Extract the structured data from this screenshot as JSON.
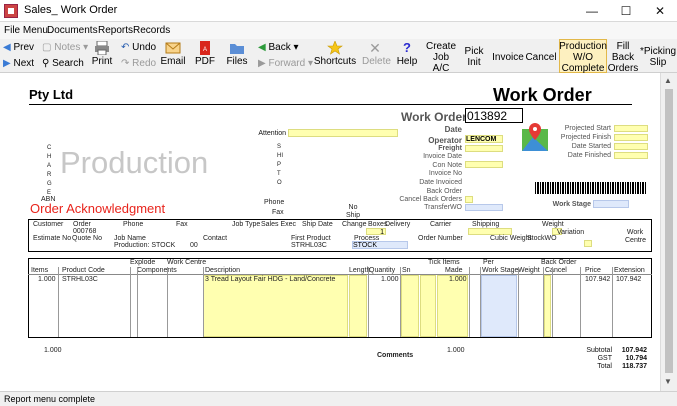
{
  "window": {
    "title": "Sales_ Work Order"
  },
  "menu": [
    "File Menu",
    "Documents",
    "Reports",
    "Records"
  ],
  "toolbar": {
    "prev": "Prev",
    "next": "Next",
    "notes": "Notes",
    "search": "Search",
    "undo": "Undo",
    "redo": "Redo",
    "print": "Print",
    "email": "Email",
    "pdf": "PDF",
    "files": "Files",
    "back": "Back",
    "forward": "Forward",
    "shortcuts": "Shortcuts",
    "delete": "Delete",
    "help": "Help",
    "actions": [
      "Create Job A/C",
      "Pick Init",
      "Invoice",
      "Cancel",
      "Production W/O Complete",
      "Fill Back Orders",
      "*Picking Slip"
    ]
  },
  "doc": {
    "company": "Pty Ltd",
    "heading": "Work Order",
    "wo_label": "Work Order",
    "wo_number": "013892",
    "production": "Production",
    "order_ack": "Order Acknowledgment",
    "attention": "Attention",
    "charge_letters": "CHARGE",
    "abn": "ABN",
    "ship_to_letters": "SHIPTO",
    "phone": "Phone",
    "fax": "Fax",
    "no_ship": "No Ship",
    "fields": {
      "date": "Date",
      "operator": "Operator",
      "operator_value": "LENCOM",
      "freight": "Freight",
      "invoice_date": "Invoice Date",
      "con_note": "Con Note",
      "invoice_no": "Invoice No",
      "date_invoiced": "Date Invoiced",
      "back_order": "Back Order",
      "cancel_back_orders": "Cancel Back Orders",
      "transfer_wo": "TransferWO",
      "work_stage": "Work Stage"
    },
    "right_fields": [
      "Projected Start",
      "Projected Finish",
      "Date Started",
      "Date Finished"
    ],
    "info_row1_labels": [
      "Customer",
      "Order",
      "Phone",
      "Fax",
      "Job Type",
      "Sales Exec",
      "Ship Date",
      "Change",
      "Boxes",
      "Delivery",
      "Carrier",
      "Shipping",
      "Weight"
    ],
    "order_value": "000768",
    "boxes_value": "1",
    "info_row2_labels": [
      "Estimate No",
      "Quote No",
      "Job Name",
      "Contact",
      "First Product",
      "Process",
      "Order Number",
      "Cubic Weight",
      "StockWO",
      "Variation",
      "Work Centre"
    ],
    "job_name_value": "Production: STOCK",
    "contact_value": "00",
    "first_product_value": "STRHL03C",
    "process_value": "STOCK",
    "lines_head1": [
      "Explode",
      "Work Centre",
      "Tick Items",
      "Per",
      "Back Order"
    ],
    "lines_head2": [
      "Items",
      "Product Code",
      "Components",
      "Description",
      "Length",
      "Quantity",
      "Sn",
      "Made",
      "Work Stage",
      "Weight",
      "Cancel",
      "Price",
      "Extension"
    ],
    "line": {
      "items": "1.000",
      "code": "STRHL03C",
      "description": "3 Tread Layout Fair HDG - Land/Concrete",
      "quantity": "1.000",
      "made": "1.000",
      "price": "107.942",
      "extension": "107.942"
    },
    "totals": {
      "items_total": "1.000",
      "comments": "Comments",
      "made_total": "1.000",
      "subtotal_label": "Subtotal",
      "subtotal": "107.942",
      "gst_label": "GST",
      "gst": "10.794",
      "total_label": "Total",
      "total": "118.737"
    }
  },
  "status": "Report menu complete"
}
